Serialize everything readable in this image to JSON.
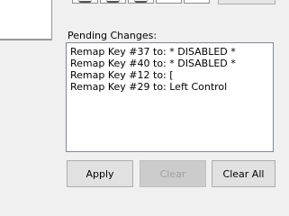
{
  "pending": {
    "label": "Pending Changes:",
    "items": [
      "Remap Key #37 to: * DISABLED *",
      "Remap Key #40 to: * DISABLED *",
      "Remap Key #12 to: [",
      "Remap Key #29 to: Left Control"
    ]
  },
  "buttons": {
    "apply": "Apply",
    "clear": "Clear",
    "clear_all": "Clear All"
  }
}
